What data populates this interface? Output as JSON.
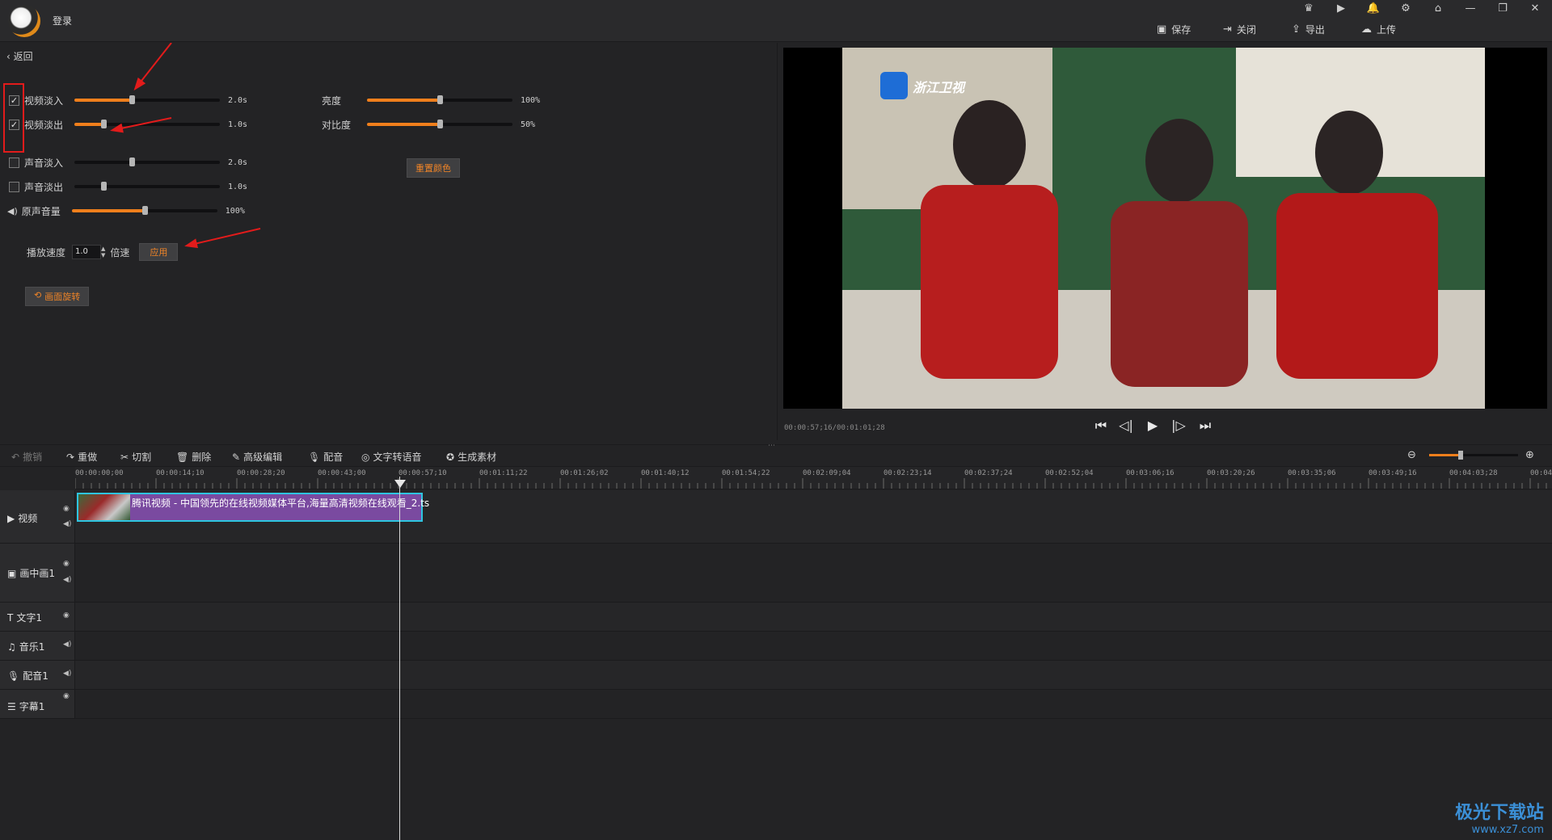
{
  "titlebar": {
    "login": "登录",
    "actions": {
      "save": "保存",
      "close": "关闭",
      "export": "导出",
      "upload": "上传"
    }
  },
  "left": {
    "back": "返回",
    "effects": [
      {
        "label": "视频淡入",
        "value": "2.0s",
        "level": 0.4,
        "checked": true
      },
      {
        "label": "视频淡出",
        "value": "1.0s",
        "level": 0.2,
        "checked": true
      },
      {
        "label": "声音淡入",
        "value": "2.0s",
        "level": 0.4,
        "checked": false
      },
      {
        "label": "声音淡出",
        "value": "1.0s",
        "level": 0.2,
        "checked": false
      }
    ],
    "volume": {
      "label": "原声音量",
      "value": "100%",
      "level": 0.5
    },
    "brightness": {
      "label": "亮度",
      "value": "100%",
      "level": 0.5
    },
    "contrast": {
      "label": "对比度",
      "value": "50%",
      "level": 0.5
    },
    "reset_color": "重置颜色",
    "speed": {
      "label": "播放速度",
      "value": "1.0",
      "unit": "倍速",
      "apply": "应用"
    },
    "rotate": "画面旋转"
  },
  "preview": {
    "channel": "浙江卫视",
    "timecode": "00:00:57;16/00:01:01;28"
  },
  "toolbar": {
    "undo": "撤销",
    "redo": "重做",
    "cut": "切割",
    "delete": "删除",
    "advanced": "高级编辑",
    "dub": "配音",
    "tts": "文字转语音",
    "generate": "生成素材"
  },
  "ruler": {
    "labels": [
      "00:00:00;00",
      "00:00:14;10",
      "00:00:28;20",
      "00:00:43;00",
      "00:00:57;10",
      "00:01:11;22",
      "00:01:26;02",
      "00:01:40;12",
      "00:01:54;22",
      "00:02:09;04",
      "00:02:23;14",
      "00:02:37;24",
      "00:02:52;04",
      "00:03:06;16",
      "00:03:20;26",
      "00:03:35;06",
      "00:03:49;16",
      "00:04:03;28",
      "00:04"
    ]
  },
  "tracks": {
    "video": "视频",
    "pip": "画中画1",
    "text": "文字1",
    "music": "音乐1",
    "dub": "配音1",
    "subtitle": "字幕1"
  },
  "clip": {
    "title": "腾讯视频 - 中国领先的在线视频媒体平台,海量高清视频在线观看_2.ts"
  },
  "watermark": {
    "name": "极光下载站",
    "url": "www.xz7.com"
  }
}
